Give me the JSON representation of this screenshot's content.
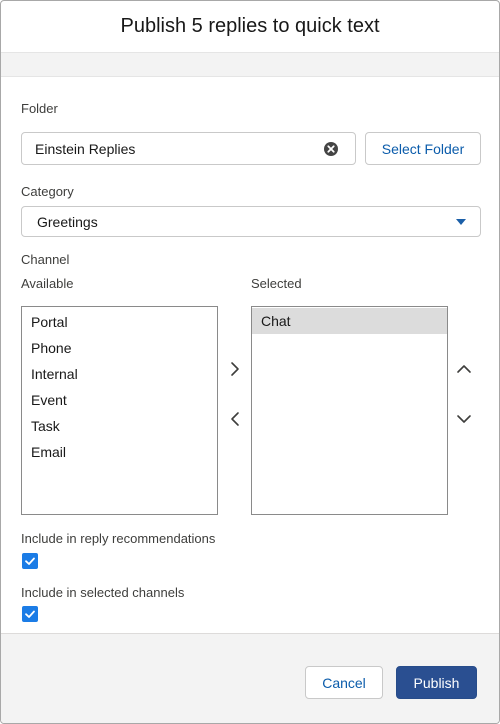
{
  "modal": {
    "title": "Publish 5 replies to quick text"
  },
  "folder": {
    "label": "Folder",
    "value": "Einstein Replies",
    "select_button": "Select Folder"
  },
  "category": {
    "label": "Category",
    "selected": "Greetings"
  },
  "channel": {
    "label": "Channel",
    "available_label": "Available",
    "selected_label": "Selected",
    "available": [
      "Portal",
      "Phone",
      "Internal",
      "Event",
      "Task",
      "Email"
    ],
    "selected": [
      "Chat"
    ]
  },
  "options": {
    "reply_recommendations": {
      "label": "Include in reply recommendations",
      "checked": true
    },
    "selected_channels": {
      "label": "Include in selected channels",
      "checked": true
    }
  },
  "footer": {
    "cancel": "Cancel",
    "publish": "Publish"
  },
  "colors": {
    "brand": "#2a4f91",
    "link": "#0b5cab",
    "checkbox": "#1b7ce6"
  }
}
